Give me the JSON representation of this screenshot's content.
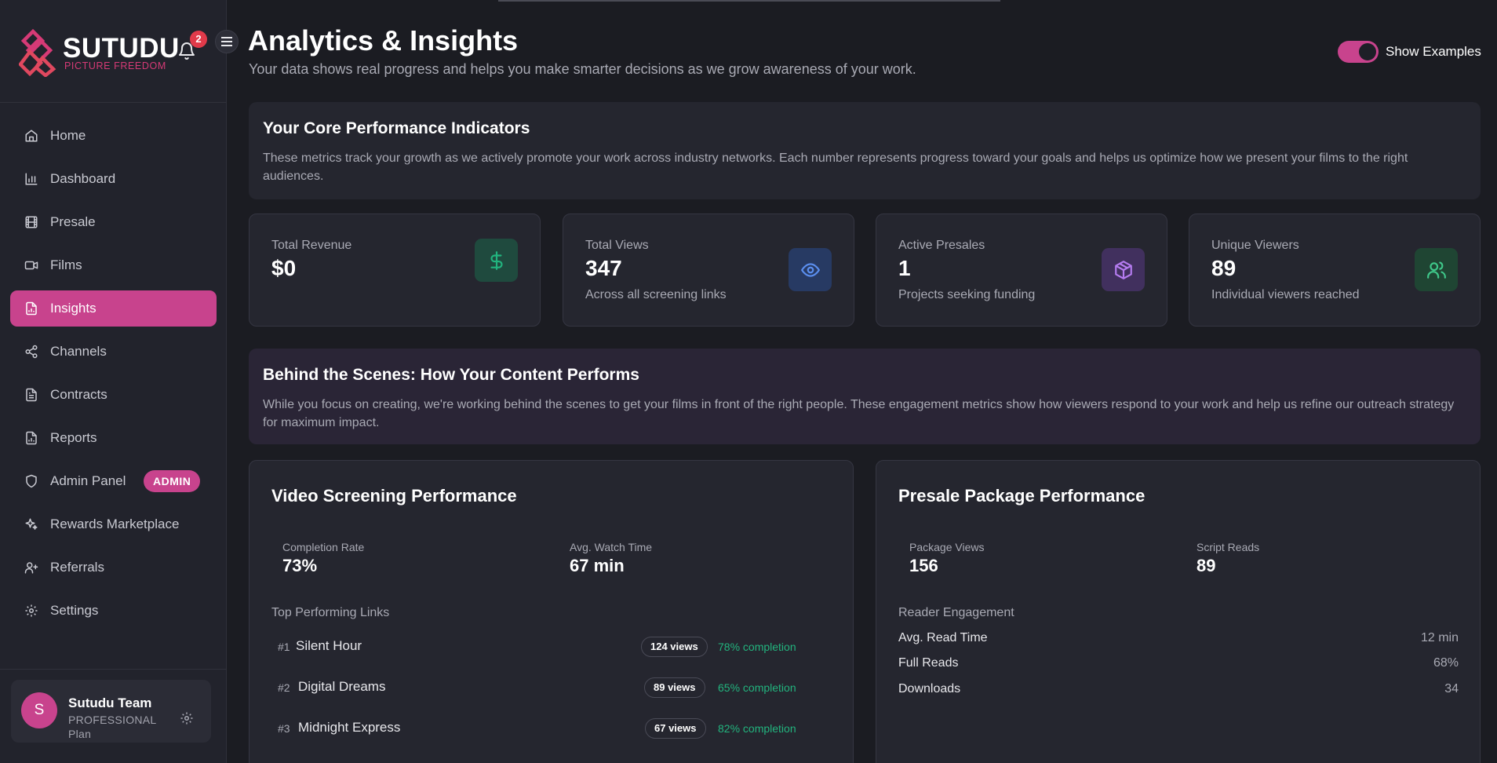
{
  "brand": {
    "name": "SUTUDU",
    "tagline": "PICTURE FREEDOM",
    "notifications": "2"
  },
  "sidebar": {
    "items": [
      {
        "label": "Home",
        "icon": "home-icon"
      },
      {
        "label": "Dashboard",
        "icon": "bar-chart-icon"
      },
      {
        "label": "Presale",
        "icon": "film-icon"
      },
      {
        "label": "Films",
        "icon": "video-icon"
      },
      {
        "label": "Insights",
        "icon": "report-icon",
        "active": true
      },
      {
        "label": "Channels",
        "icon": "share-icon"
      },
      {
        "label": "Contracts",
        "icon": "document-icon"
      },
      {
        "label": "Reports",
        "icon": "report-icon"
      },
      {
        "label": "Admin Panel",
        "icon": "shield-icon",
        "badge": "ADMIN"
      },
      {
        "label": "Rewards Marketplace",
        "icon": "sparkles-icon"
      },
      {
        "label": "Referrals",
        "icon": "user-plus-icon"
      },
      {
        "label": "Settings",
        "icon": "gear-icon"
      }
    ],
    "user": {
      "initial": "S",
      "name": "Sutudu Team",
      "plan": "PROFESSIONAL Plan"
    }
  },
  "header": {
    "title": "Analytics & Insights",
    "subtitle": "Your data shows real progress and helps you make smarter decisions as we grow awareness of your work.",
    "toggle_label": "Show Examples",
    "toggle_on": true
  },
  "core": {
    "title": "Your Core Performance Indicators",
    "description": "These metrics track your growth as we actively promote your work across industry networks. Each number represents progress toward your goals and helps us optimize how we present your films to the right audiences."
  },
  "stats": [
    {
      "label": "Total Revenue",
      "value": "$0",
      "desc": "",
      "icon": "dollar-icon",
      "color": "#22b47e"
    },
    {
      "label": "Total Views",
      "value": "347",
      "desc": "Across all screening links",
      "icon": "eye-icon",
      "color": "#5b8ff0"
    },
    {
      "label": "Active Presales",
      "value": "1",
      "desc": "Projects seeking funding",
      "icon": "package-icon",
      "color": "#b57cf0"
    },
    {
      "label": "Unique Viewers",
      "value": "89",
      "desc": "Individual viewers reached",
      "icon": "users-icon",
      "color": "#3fc88a"
    }
  ],
  "behind": {
    "title": "Behind the Scenes: How Your Content Performs",
    "description": "While you focus on creating, we're working behind the scenes to get your films in front of the right people. These engagement metrics show how viewers respond to your work and help us refine our outreach strategy for maximum impact."
  },
  "video": {
    "title": "Video Screening Performance",
    "completion_label": "Completion Rate",
    "completion_value": "73%",
    "watch_label": "Avg. Watch Time",
    "watch_value": "67 min",
    "links_label": "Top Performing Links",
    "links": [
      {
        "rank": "#1",
        "name": "Silent Hour",
        "views": "124 views",
        "completion": "78% completion"
      },
      {
        "rank": "#2",
        "name": "Digital Dreams",
        "views": "89 views",
        "completion": "65% completion"
      },
      {
        "rank": "#3",
        "name": "Midnight Express",
        "views": "67 views",
        "completion": "82% completion"
      }
    ]
  },
  "presale": {
    "title": "Presale Package Performance",
    "package_label": "Package Views",
    "package_value": "156",
    "script_label": "Script Reads",
    "script_value": "89",
    "engagement_label": "Reader Engagement",
    "rows": [
      {
        "label": "Avg. Read Time",
        "value": "12 min"
      },
      {
        "label": "Full Reads",
        "value": "68%"
      },
      {
        "label": "Downloads",
        "value": "34"
      }
    ]
  }
}
